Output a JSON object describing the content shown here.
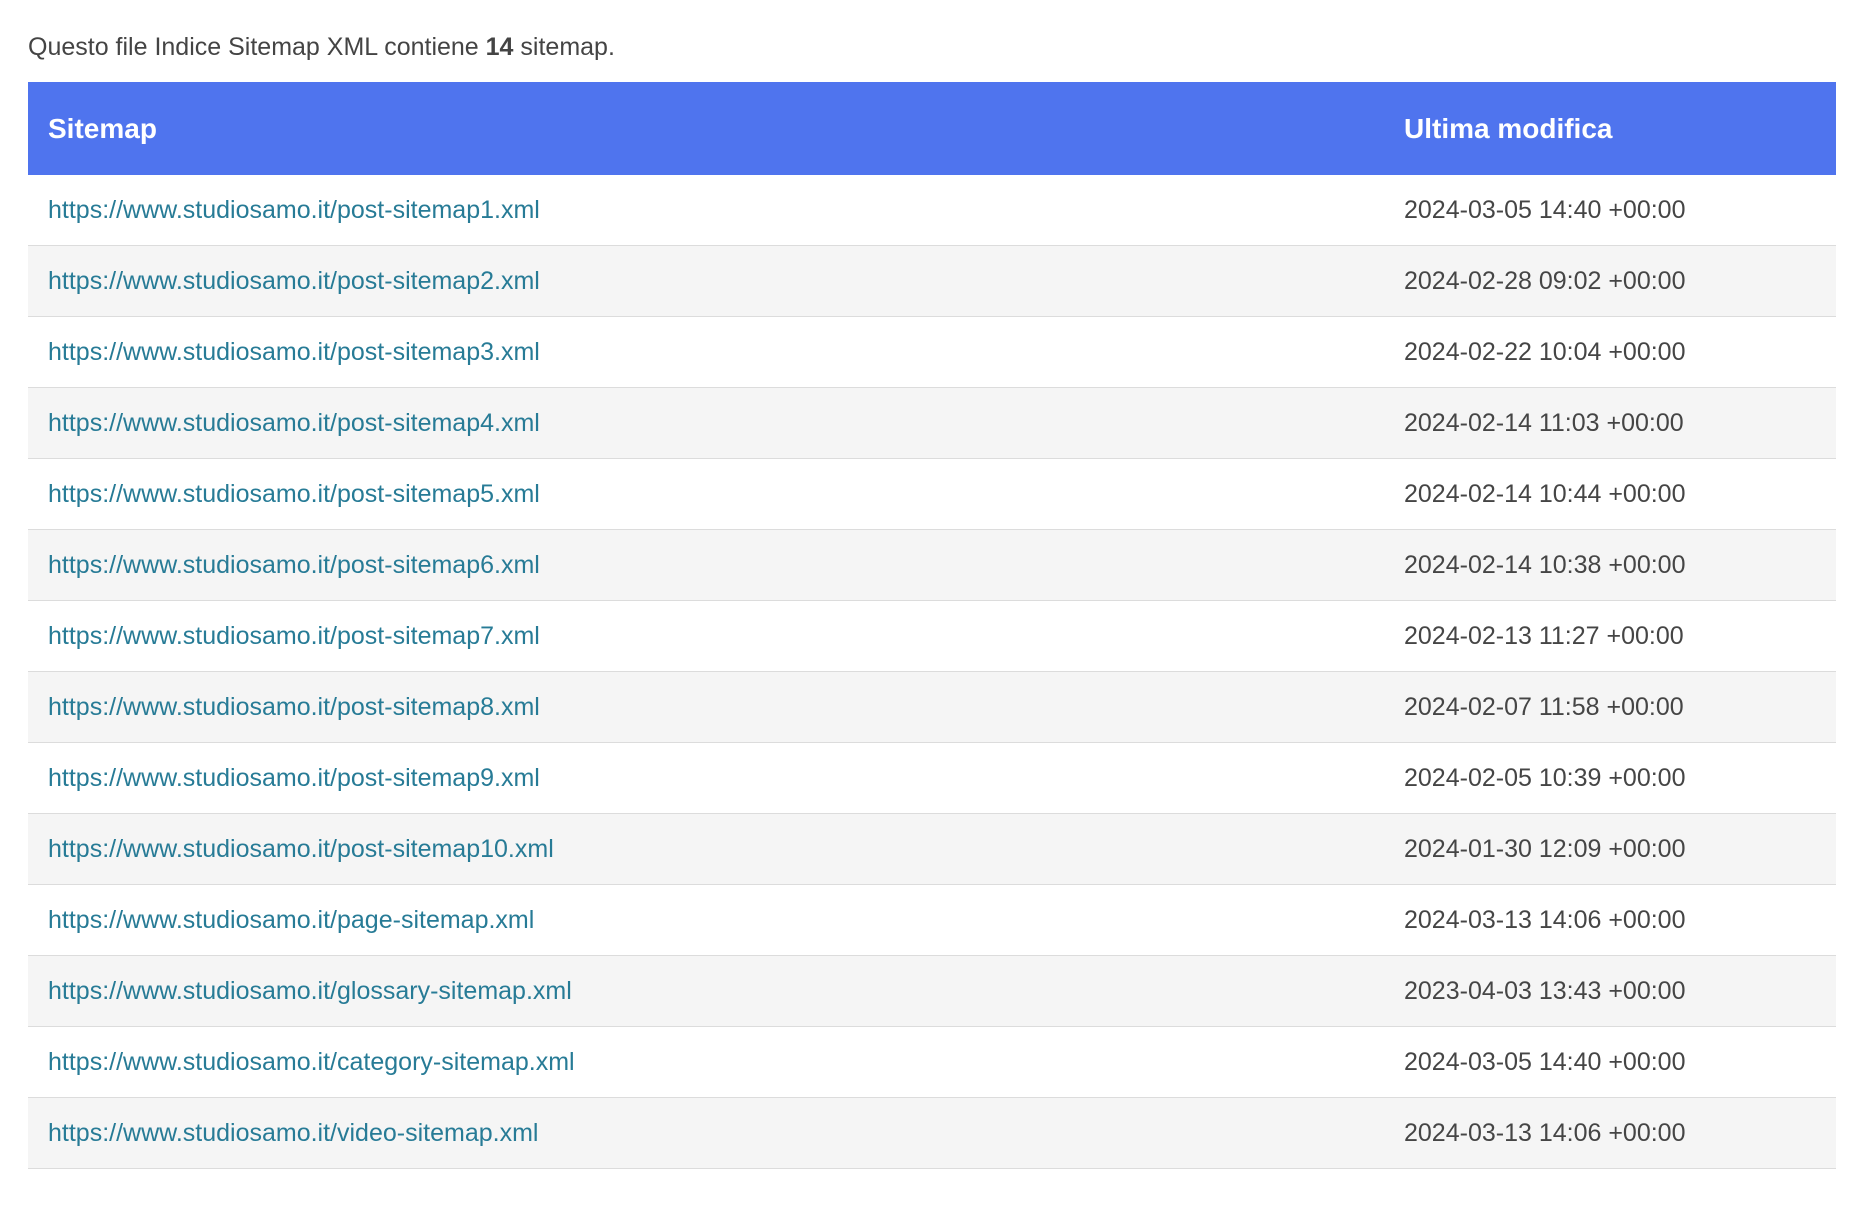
{
  "intro": {
    "prefix": "Questo file Indice Sitemap XML contiene ",
    "count": "14",
    "suffix": " sitemap."
  },
  "table": {
    "headers": {
      "sitemap": "Sitemap",
      "last_modified": "Ultima modifica"
    },
    "rows": [
      {
        "url": "https://www.studiosamo.it/post-sitemap1.xml",
        "lastmod": "2024-03-05 14:40 +00:00"
      },
      {
        "url": "https://www.studiosamo.it/post-sitemap2.xml",
        "lastmod": "2024-02-28 09:02 +00:00"
      },
      {
        "url": "https://www.studiosamo.it/post-sitemap3.xml",
        "lastmod": "2024-02-22 10:04 +00:00"
      },
      {
        "url": "https://www.studiosamo.it/post-sitemap4.xml",
        "lastmod": "2024-02-14 11:03 +00:00"
      },
      {
        "url": "https://www.studiosamo.it/post-sitemap5.xml",
        "lastmod": "2024-02-14 10:44 +00:00"
      },
      {
        "url": "https://www.studiosamo.it/post-sitemap6.xml",
        "lastmod": "2024-02-14 10:38 +00:00"
      },
      {
        "url": "https://www.studiosamo.it/post-sitemap7.xml",
        "lastmod": "2024-02-13 11:27 +00:00"
      },
      {
        "url": "https://www.studiosamo.it/post-sitemap8.xml",
        "lastmod": "2024-02-07 11:58 +00:00"
      },
      {
        "url": "https://www.studiosamo.it/post-sitemap9.xml",
        "lastmod": "2024-02-05 10:39 +00:00"
      },
      {
        "url": "https://www.studiosamo.it/post-sitemap10.xml",
        "lastmod": "2024-01-30 12:09 +00:00"
      },
      {
        "url": "https://www.studiosamo.it/page-sitemap.xml",
        "lastmod": "2024-03-13 14:06 +00:00"
      },
      {
        "url": "https://www.studiosamo.it/glossary-sitemap.xml",
        "lastmod": "2023-04-03 13:43 +00:00"
      },
      {
        "url": "https://www.studiosamo.it/category-sitemap.xml",
        "lastmod": "2024-03-05 14:40 +00:00"
      },
      {
        "url": "https://www.studiosamo.it/video-sitemap.xml",
        "lastmod": "2024-03-13 14:06 +00:00"
      }
    ]
  },
  "colors": {
    "header_bg": "#4f74ee",
    "header_text": "#ffffff",
    "link": "#277b96",
    "row_alt": "#f5f5f5",
    "text": "#444444"
  }
}
